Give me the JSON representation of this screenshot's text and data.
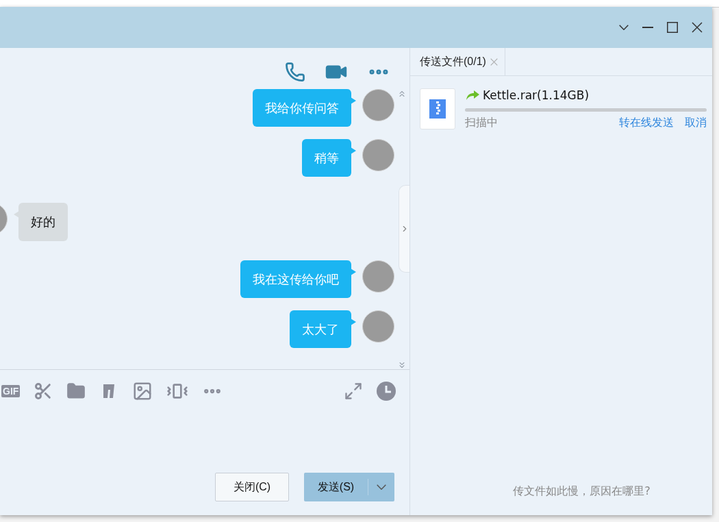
{
  "chat": {
    "messages": [
      {
        "kind": "self",
        "text": "我给你传问答"
      },
      {
        "kind": "self",
        "text": "稍等"
      },
      {
        "kind": "other",
        "text": "好的"
      },
      {
        "kind": "self",
        "text": "我在这传给你吧"
      },
      {
        "kind": "self",
        "text": "太大了"
      }
    ]
  },
  "toolbar": {
    "gif_label": "GIF"
  },
  "buttons": {
    "close": "关闭(C)",
    "send": "发送(S)"
  },
  "transfer": {
    "tab": {
      "label": "传送文件(0/1)",
      "selected": true
    },
    "file": {
      "name": "Kettle.rar(1.14GB)",
      "status": "扫描中",
      "level": 0,
      "actions": [
        "转在线发送",
        "取消"
      ]
    },
    "footer_link": "传文件如此慢，原因在哪里?"
  }
}
